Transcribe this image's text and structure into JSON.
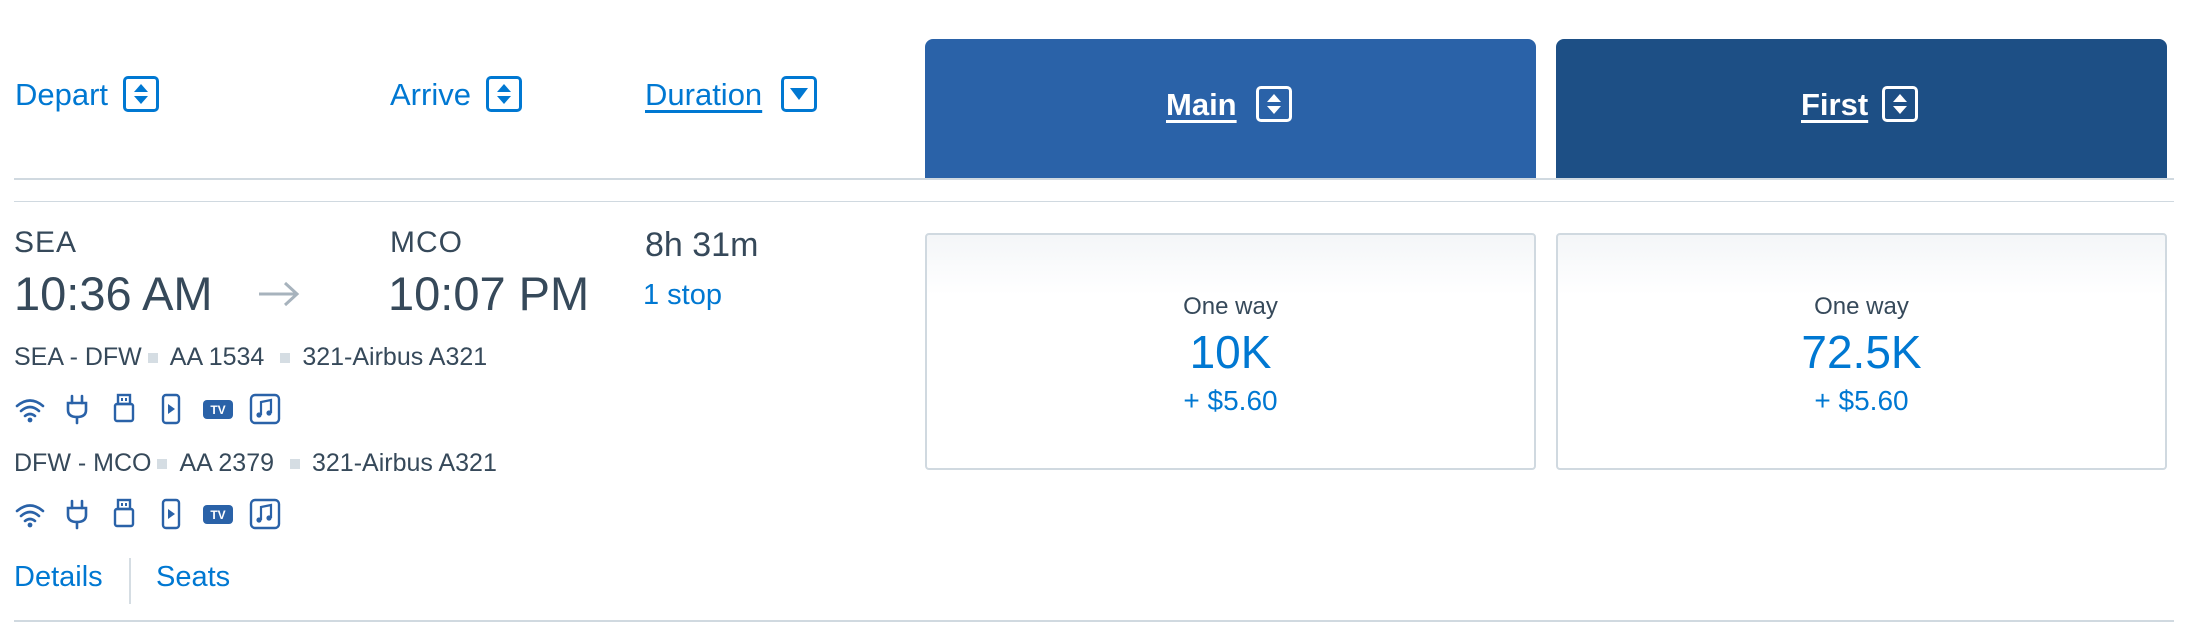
{
  "header": {
    "depart_label": "Depart",
    "arrive_label": "Arrive",
    "duration_label": "Duration",
    "cabins": [
      {
        "label": "Main",
        "color": "#2a62a8"
      },
      {
        "label": "First",
        "color": "#1d4f85"
      }
    ]
  },
  "flight": {
    "origin": "SEA",
    "depart_time": "10:36 AM",
    "destination": "MCO",
    "arrive_time": "10:07 PM",
    "duration": "8h 31m",
    "stops": "1 stop",
    "segments": [
      {
        "route": "SEA - DFW",
        "flight_number": "AA 1534",
        "aircraft": "321-Airbus A321",
        "amenities": [
          "wifi-icon",
          "power-outlet-icon",
          "usb-icon",
          "device-entertainment-icon",
          "tv-icon",
          "music-icon"
        ],
        "tv_text": "TV"
      },
      {
        "route": "DFW - MCO",
        "flight_number": "AA 2379",
        "aircraft": "321-Airbus A321",
        "amenities": [
          "wifi-icon",
          "power-outlet-icon",
          "usb-icon",
          "device-entertainment-icon",
          "tv-icon",
          "music-icon"
        ],
        "tv_text": "TV"
      }
    ],
    "links": {
      "details": "Details",
      "seats": "Seats"
    }
  },
  "fares": [
    {
      "type": "One way",
      "points": "10K",
      "tax": "+ $5.60"
    },
    {
      "type": "One way",
      "points": "72.5K",
      "tax": "+ $5.60"
    }
  ],
  "colors": {
    "accent": "#0078d2",
    "main_tab": "#2a62a8",
    "first_tab": "#1d4f85",
    "text": "#36495a",
    "divider": "#d0d9e0"
  }
}
